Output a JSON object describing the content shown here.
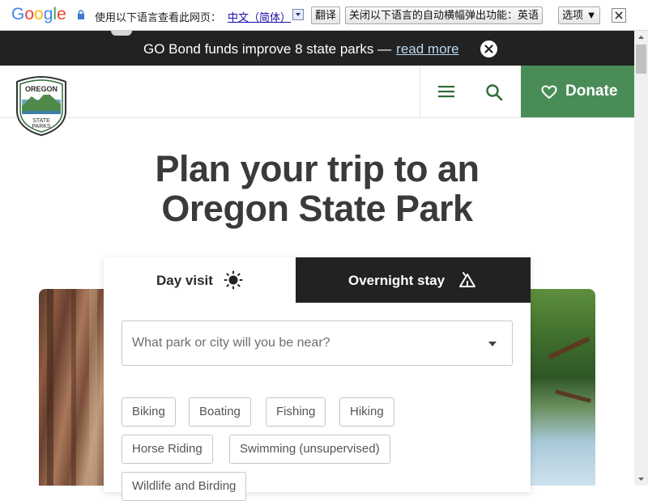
{
  "translate_bar": {
    "logo_letters": [
      "G",
      "o",
      "o",
      "g",
      "l",
      "e"
    ],
    "logo_colors": [
      "#4285f4",
      "#ea4335",
      "#fbbc05",
      "#4285f4",
      "#34a853",
      "#ea4335"
    ],
    "prompt": "使用以下语言查看此网页：",
    "language": "中文（简体）",
    "translate_button": "翻译",
    "disable_button": "关闭以下语言的自动横幅弹出功能：英语",
    "options_button": "选项 ▼"
  },
  "announcement": {
    "text": "GO Bond funds improve 8 state parks —",
    "link": "read more"
  },
  "header": {
    "logo_text_top": "OREGON",
    "logo_text_bottom": "STATE PARKS",
    "donate_label": "Donate"
  },
  "hero": {
    "title_line1": "Plan your trip to an",
    "title_line2": "Oregon State Park"
  },
  "planner": {
    "tabs": [
      {
        "label": "Day visit",
        "active": true
      },
      {
        "label": "Overnight stay",
        "active": false
      }
    ],
    "search_placeholder": "What park or city will you be near?",
    "activities": [
      "Biking",
      "Boating",
      "Fishing",
      "Hiking",
      "Horse Riding",
      "Swimming (unsupervised)",
      "Wildlife and Birding"
    ]
  },
  "colors": {
    "donate_green": "#4a8c57",
    "dark_bar": "#222222"
  }
}
